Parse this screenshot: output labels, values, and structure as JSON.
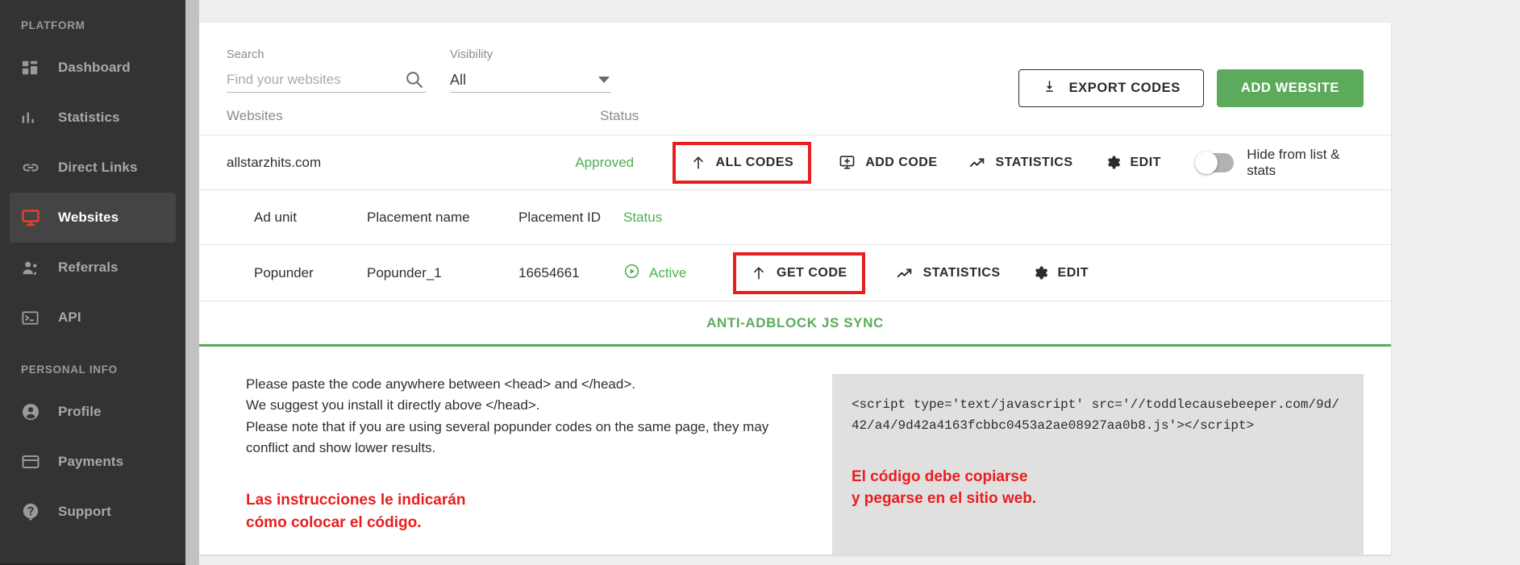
{
  "sidebar": {
    "sections": [
      {
        "label": "PLATFORM"
      },
      {
        "label": "PERSONAL INFO"
      }
    ],
    "platform_items": [
      {
        "label": "Dashboard",
        "icon": "dashboard-icon"
      },
      {
        "label": "Statistics",
        "icon": "bar-chart-icon"
      },
      {
        "label": "Direct Links",
        "icon": "link-icon"
      },
      {
        "label": "Websites",
        "icon": "monitor-icon"
      },
      {
        "label": "Referrals",
        "icon": "people-icon"
      },
      {
        "label": "API",
        "icon": "terminal-icon"
      }
    ],
    "personal_items": [
      {
        "label": "Profile",
        "icon": "user-circle-icon"
      },
      {
        "label": "Payments",
        "icon": "credit-card-icon"
      },
      {
        "label": "Support",
        "icon": "help-circle-icon"
      }
    ],
    "active_item": "Websites"
  },
  "toolbar": {
    "search_label": "Search",
    "search_placeholder": "Find your websites",
    "search_value": "",
    "visibility_label": "Visibility",
    "visibility_value": "All",
    "export_label": "EXPORT CODES",
    "add_website_label": "ADD WEBSITE"
  },
  "websites_table": {
    "headers": {
      "site": "Websites",
      "status": "Status"
    },
    "row": {
      "name": "allstarzhits.com",
      "status": "Approved",
      "all_codes_label": "ALL CODES",
      "add_code_label": "ADD CODE",
      "statistics_label": "STATISTICS",
      "edit_label": "EDIT",
      "hide_toggle_label": "Hide from list & stats",
      "hide_toggle_on": false
    }
  },
  "placements_table": {
    "headers": {
      "ad_unit": "Ad unit",
      "placement_name": "Placement name",
      "placement_id": "Placement ID",
      "status": "Status"
    },
    "rows": [
      {
        "ad_unit": "Popunder",
        "placement_name": "Popunder_1",
        "placement_id": "16654661",
        "status": "Active",
        "get_code_label": "GET CODE",
        "statistics_label": "STATISTICS",
        "edit_label": "EDIT"
      }
    ]
  },
  "code_panel": {
    "tab_label": "ANTI-ADBLOCK JS SYNC",
    "instructions": [
      "Please paste the code anywhere between <head> and </head>.",
      "We suggest you install it directly above </head>.",
      "Please note that if you are using several popunder codes on the same page, they may conflict and show lower results."
    ],
    "code": "<script type='text/javascript' src='//toddlecausebeeper.com/9d/42/a4/9d42a4163fcbbc0453a2ae08927aa0b8.js'></script>",
    "annotation_left": "Las instrucciones le indicarán\ncómo colocar el código.",
    "annotation_right": "El código debe copiarse\ny pegarse en el sitio web."
  },
  "colors": {
    "accent_red": "#e8402a",
    "annotation_red": "#e81e1e",
    "green": "#5cab5c",
    "status_green": "#4caf50",
    "sidebar_bg": "#333333",
    "page_bg": "#efefef"
  }
}
